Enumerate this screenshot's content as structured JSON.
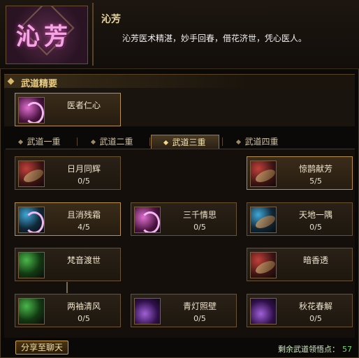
{
  "header": {
    "emblem_text": "沁芳",
    "name": "沁芳",
    "description": "沁芳医术精湛，妙手回春，借花济世，凭心医人。"
  },
  "section": {
    "title": "武道精要",
    "main_skill": {
      "name": "医者仁心",
      "icon": "pink-swirl-icon"
    }
  },
  "tabs": [
    {
      "label": "武道一重",
      "active": false
    },
    {
      "label": "武道二重",
      "active": false
    },
    {
      "label": "武道三重",
      "active": true
    },
    {
      "label": "武道四重",
      "active": false
    }
  ],
  "skills": [
    {
      "name": "日月同辉",
      "count": "0/5",
      "icon": "red-blade-icon"
    },
    {
      "name": "惊鹊献芳",
      "count": "5/5",
      "icon": "red-blade-icon",
      "active": true
    },
    {
      "name": "且消残霜",
      "count": "4/5",
      "icon": "blue-swirl-icon",
      "active": true
    },
    {
      "name": "三千情思",
      "count": "0/5",
      "icon": "pink-swirl-icon"
    },
    {
      "name": "天地一隅",
      "count": "0/5",
      "icon": "blue-blade-icon"
    },
    {
      "name": "梵音渡世",
      "count": "",
      "icon": "green-icon"
    },
    {
      "name": "暗香透",
      "count": "",
      "icon": "red-blade-icon"
    },
    {
      "name": "两袖清风",
      "count": "0/5",
      "icon": "green-icon"
    },
    {
      "name": "青灯照壁",
      "count": "0/5",
      "icon": "purple-icon"
    },
    {
      "name": "秋花春解",
      "count": "0/5",
      "icon": "purple-icon"
    }
  ],
  "footer": {
    "share_label": "分享至聊天",
    "remaining_label": "剩余武道领悟点：",
    "remaining_value": "57"
  },
  "colors": {
    "accent_gold": "#e9cf8a",
    "remaining_green": "#6ed86e",
    "emblem_pink": "#f0a8e0"
  }
}
